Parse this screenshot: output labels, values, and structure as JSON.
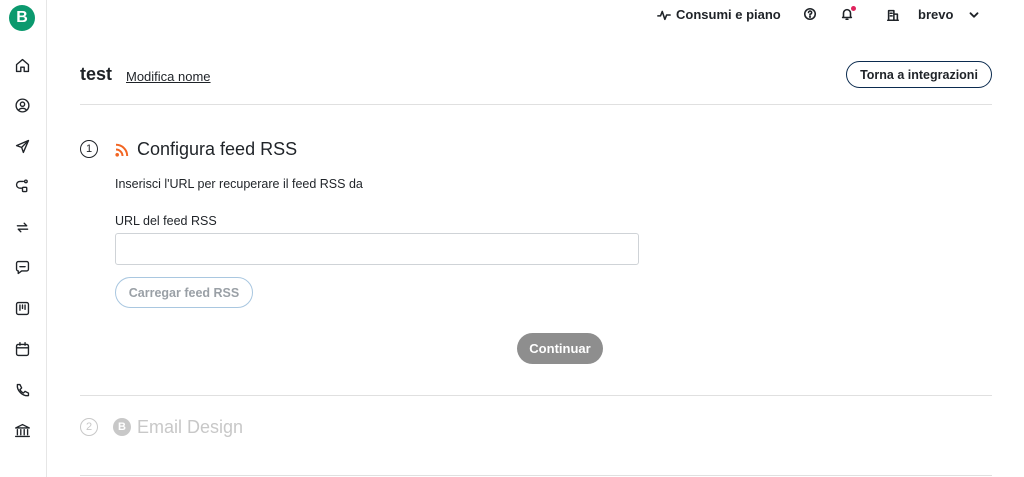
{
  "sidebar": {
    "logo_letter": "B",
    "items": [
      {
        "name": "home",
        "icon": "home-icon"
      },
      {
        "name": "contacts",
        "icon": "user-circle-icon"
      },
      {
        "name": "campaigns",
        "icon": "send-icon"
      },
      {
        "name": "automations",
        "icon": "flow-icon"
      },
      {
        "name": "transactional",
        "icon": "repeat-icon"
      },
      {
        "name": "conversations",
        "icon": "chat-icon"
      },
      {
        "name": "deals",
        "icon": "kanban-icon"
      },
      {
        "name": "meetings",
        "icon": "calendar-icon"
      },
      {
        "name": "phone",
        "icon": "phone-icon"
      },
      {
        "name": "payments",
        "icon": "bank-icon"
      }
    ]
  },
  "topbar": {
    "usage_label": "Consumi e piano",
    "account_name": "brevo"
  },
  "header": {
    "title": "test",
    "edit_name_label": "Modifica nome",
    "back_button_label": "Torna a integrazioni"
  },
  "step1": {
    "number": "1",
    "title": "Configura feed RSS",
    "description": "Inserisci l'URL per recuperare il feed RSS da",
    "field_label": "URL del feed RSS",
    "field_value": "",
    "load_button_label": "Carregar feed RSS",
    "continue_button_label": "Continuar"
  },
  "step2": {
    "number": "2",
    "logo_letter": "B",
    "title": "Email Design"
  },
  "colors": {
    "brand_green": "#0b996e",
    "rss_orange": "#f26522",
    "disabled_gray": "#c8c8c8"
  }
}
